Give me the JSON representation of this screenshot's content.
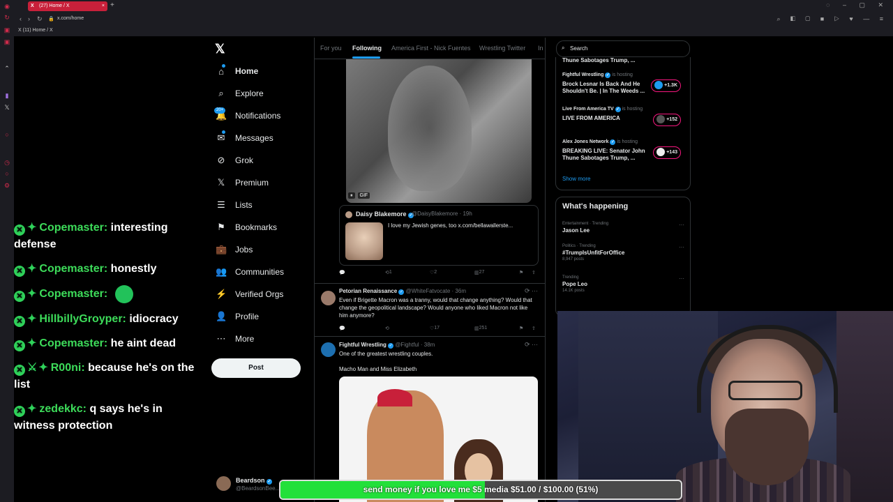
{
  "browser": {
    "tab_title": "(27) Home / X",
    "url": "x.com/home",
    "bookmark": "(11) Home / X"
  },
  "chat": [
    {
      "user": "Copemaster:",
      "text": "interesting defense",
      "emote": false
    },
    {
      "user": "Copemaster:",
      "text": "honestly",
      "emote": false
    },
    {
      "user": "Copemaster:",
      "text": "",
      "emote": true
    },
    {
      "user": "HillbillyGroyper:",
      "text": "idiocracy",
      "emote": false
    },
    {
      "user": "Copemaster:",
      "text": "he aint dead",
      "emote": false
    },
    {
      "user": "R00ni:",
      "text": "because he's on the list",
      "emote": false
    },
    {
      "user": "zedekkc:",
      "text": "q says he's in witness protection",
      "emote": false
    }
  ],
  "nav": {
    "items": [
      "Home",
      "Explore",
      "Notifications",
      "Messages",
      "Grok",
      "Premium",
      "Lists",
      "Bookmarks",
      "Jobs",
      "Communities",
      "Verified Orgs",
      "Profile",
      "More"
    ],
    "notif_badge": "20+",
    "post_label": "Post",
    "account_name": "Beardson",
    "account_handle": "@BeardsonBee..."
  },
  "timeline": {
    "tabs": [
      "For you",
      "Following",
      "America First - Nick Fuentes",
      "Wrestling Twitter",
      "In"
    ],
    "gif_label": "GIF",
    "quote": {
      "name": "Daisy Blakemore",
      "handle": "@DaisyBlakemore · 19h",
      "text": "I love my Jewish genes, too  x.com/bellawallerste..."
    },
    "post1_actions": {
      "retweets": "1",
      "likes": "2",
      "views": "27"
    },
    "post2": {
      "name": "Petorian Renaissance",
      "handle": "@WhiteFatvocate · 36m",
      "text": "Even if Brigette Macron was a tranny, would that change anything? Would that change the geopolitical landscape? Would anyone who liked Macron not like him anymore?",
      "likes": "17",
      "views": "251"
    },
    "post3": {
      "name": "Fightful Wrestling",
      "handle": "@Fightful · 38m",
      "text1": "One of the greatest wrestling couples.",
      "text2": "Macho Man and  Miss Elizabeth"
    }
  },
  "sidebar": {
    "search_placeholder": "Search",
    "spaces": [
      {
        "host": "",
        "title": "Thune Sabotages Trump, ...",
        "count": ""
      },
      {
        "host": "Fightful Wrestling",
        "title": "Brock Lesnar Is Back And He Shouldn't Be. | In The Weeds ...",
        "count": "+1.3K"
      },
      {
        "host": "Live From America TV",
        "title": "LIVE FROM AMERICA",
        "count": "+152"
      },
      {
        "host": "Alex Jones Network",
        "title": "BREAKING LIVE: Senator John Thune Sabotages Trump, ...",
        "count": "+143"
      }
    ],
    "is_hosting": "is hosting",
    "show_more": "Show more",
    "happening_title": "What's happening",
    "trends": [
      {
        "meta": "Entertainment · Trending",
        "name": "Jason Lee",
        "posts": ""
      },
      {
        "meta": "Politics · Trending",
        "name": "#TrumpIsUnfitForOffice",
        "posts": "8,947 posts"
      },
      {
        "meta": "Trending",
        "name": "Pope Leo",
        "posts": "14.1K posts"
      }
    ]
  },
  "donation": {
    "text": "send money if you love me $5 media $51.00 / $100.00 (51%)",
    "progress": 0.51,
    "fill_color": "#22e03a"
  }
}
